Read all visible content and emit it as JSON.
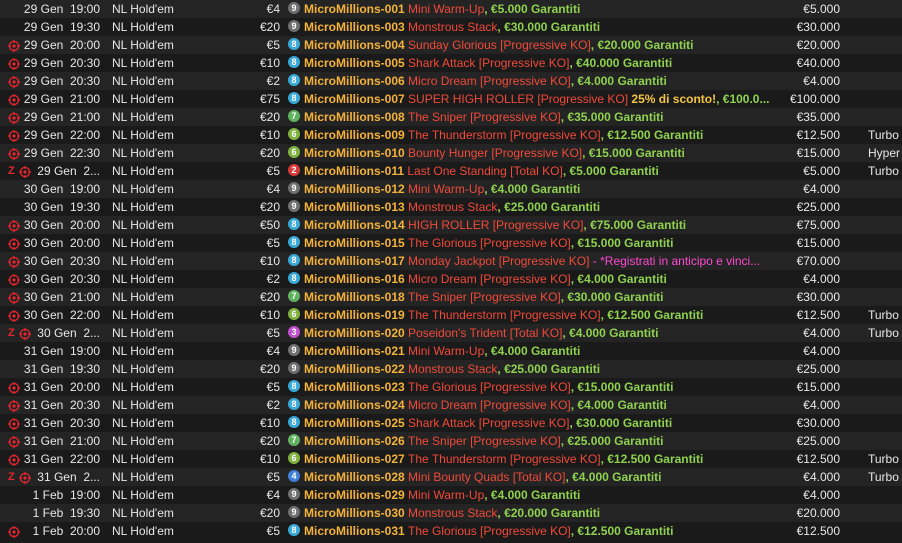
{
  "colors": {
    "code": "#f4b23b",
    "title": "#f04a3a",
    "guarantee": "#8fd14f",
    "promo": "#f4c542",
    "promo_pink": "#ff49d2",
    "ko_icon": "#e3262f",
    "badge_colors": {
      "9": "#6f6f6f",
      "8": "#39a9d8",
      "7": "#5fb35f",
      "6": "#7fb340",
      "5": "#3ec0c9",
      "4": "#3f7fd8",
      "3": "#c24fd0",
      "2": "#d63a3a"
    }
  },
  "rows": [
    {
      "ko": false,
      "z": false,
      "date": "29 Gen",
      "time": "19:00",
      "game": "NL Hold'em",
      "buyin": "€4",
      "badge": "9",
      "code": "MicroMillions-001",
      "title": "Mini Warm-Up",
      "gtd": ", €5.000 Garantiti",
      "promo": "",
      "prize": "€5.000",
      "speed": ""
    },
    {
      "ko": false,
      "z": false,
      "date": "29 Gen",
      "time": "19:30",
      "game": "NL Hold'em",
      "buyin": "€20",
      "badge": "9",
      "code": "MicroMillions-003",
      "title": "Monstrous Stack",
      "gtd": ", €30.000 Garantiti",
      "promo": "",
      "prize": "€30.000",
      "speed": ""
    },
    {
      "ko": true,
      "z": false,
      "date": "29 Gen",
      "time": "20:00",
      "game": "NL Hold'em",
      "buyin": "€5",
      "badge": "8",
      "code": "MicroMillions-004",
      "title": "Sunday Glorious [Progressive KO]",
      "gtd": ", €20.000 Garantiti",
      "promo": "",
      "prize": "€20.000",
      "speed": ""
    },
    {
      "ko": true,
      "z": false,
      "date": "29 Gen",
      "time": "20:30",
      "game": "NL Hold'em",
      "buyin": "€10",
      "badge": "8",
      "code": "MicroMillions-005",
      "title": "Shark Attack [Progressive KO]",
      "gtd": ", €40.000 Garantiti",
      "promo": "",
      "prize": "€40.000",
      "speed": ""
    },
    {
      "ko": true,
      "z": false,
      "date": "29 Gen",
      "time": "20:30",
      "game": "NL Hold'em",
      "buyin": "€2",
      "badge": "8",
      "code": "MicroMillions-006",
      "title": "Micro Dream [Progressive KO]",
      "gtd": ", €4.000 Garantiti",
      "promo": "",
      "prize": "€4.000",
      "speed": ""
    },
    {
      "ko": true,
      "z": false,
      "date": "29 Gen",
      "time": "21:00",
      "game": "NL Hold'em",
      "buyin": "€75",
      "badge": "8",
      "code": "MicroMillions-007",
      "title": "SUPER HIGH ROLLER [Progressive KO]",
      "gtd": ", €100.0...",
      "promo": "  25% di sconto!",
      "prize": "€100.000",
      "speed": ""
    },
    {
      "ko": true,
      "z": false,
      "date": "29 Gen",
      "time": "21:00",
      "game": "NL Hold'em",
      "buyin": "€20",
      "badge": "7",
      "code": "MicroMillions-008",
      "title": "The Sniper [Progressive KO]",
      "gtd": ", €35.000 Garantiti",
      "promo": "",
      "prize": "€35.000",
      "speed": ""
    },
    {
      "ko": true,
      "z": false,
      "date": "29 Gen",
      "time": "22:00",
      "game": "NL Hold'em",
      "buyin": "€10",
      "badge": "6",
      "code": "MicroMillions-009",
      "title": "The Thunderstorm [Progressive KO]",
      "gtd": ", €12.500 Garantiti",
      "promo": "",
      "prize": "€12.500",
      "speed": "Turbo"
    },
    {
      "ko": true,
      "z": false,
      "date": "29 Gen",
      "time": "22:30",
      "game": "NL Hold'em",
      "buyin": "€20",
      "badge": "6",
      "code": "MicroMillions-010",
      "title": "Bounty Hunger [Progressive KO]",
      "gtd": ", €15.000 Garantiti",
      "promo": "",
      "prize": "€15.000",
      "speed": "Hyper"
    },
    {
      "ko": true,
      "z": true,
      "date": "29 Gen",
      "time": "2...",
      "game": "NL Hold'em",
      "buyin": "€5",
      "badge": "2",
      "code": "MicroMillions-011",
      "title": "Last One Standing [Total KO]",
      "gtd": ", €5.000 Garantiti",
      "promo": "",
      "prize": "€5.000",
      "speed": "Turbo"
    },
    {
      "ko": false,
      "z": false,
      "date": "30 Gen",
      "time": "19:00",
      "game": "NL Hold'em",
      "buyin": "€4",
      "badge": "9",
      "code": "MicroMillions-012",
      "title": "Mini Warm-Up",
      "gtd": ", €4.000 Garantiti",
      "promo": "",
      "prize": "€4.000",
      "speed": ""
    },
    {
      "ko": false,
      "z": false,
      "date": "30 Gen",
      "time": "19:30",
      "game": "NL Hold'em",
      "buyin": "€20",
      "badge": "9",
      "code": "MicroMillions-013",
      "title": "Monstrous Stack",
      "gtd": ", €25.000 Garantiti",
      "promo": "",
      "prize": "€25.000",
      "speed": ""
    },
    {
      "ko": true,
      "z": false,
      "date": "30 Gen",
      "time": "20:00",
      "game": "NL Hold'em",
      "buyin": "€50",
      "badge": "8",
      "code": "MicroMillions-014",
      "title": "HIGH ROLLER [Progressive KO]",
      "gtd": ", €75.000 Garantiti",
      "promo": "",
      "prize": "€75.000",
      "speed": ""
    },
    {
      "ko": true,
      "z": false,
      "date": "30 Gen",
      "time": "20:00",
      "game": "NL Hold'em",
      "buyin": "€5",
      "badge": "8",
      "code": "MicroMillions-015",
      "title": "The Glorious [Progressive KO]",
      "gtd": ", €15.000 Garantiti",
      "promo": "",
      "prize": "€15.000",
      "speed": ""
    },
    {
      "ko": true,
      "z": false,
      "date": "30 Gen",
      "time": "20:30",
      "game": "NL Hold'em",
      "buyin": "€10",
      "badge": "8",
      "code": "MicroMillions-017",
      "title": "Monday Jackpot [Progressive KO]",
      "gtd": "",
      "promo": " - *Registrati in anticipo e vinci...",
      "prize": "€70.000",
      "speed": ""
    },
    {
      "ko": true,
      "z": false,
      "date": "30 Gen",
      "time": "20:30",
      "game": "NL Hold'em",
      "buyin": "€2",
      "badge": "8",
      "code": "MicroMillions-016",
      "title": "Micro Dream [Progressive KO]",
      "gtd": ", €4.000 Garantiti",
      "promo": "",
      "prize": "€4.000",
      "speed": ""
    },
    {
      "ko": true,
      "z": false,
      "date": "30 Gen",
      "time": "21:00",
      "game": "NL Hold'em",
      "buyin": "€20",
      "badge": "7",
      "code": "MicroMillions-018",
      "title": "The Sniper [Progressive KO]",
      "gtd": ", €30.000 Garantiti",
      "promo": "",
      "prize": "€30.000",
      "speed": ""
    },
    {
      "ko": true,
      "z": false,
      "date": "30 Gen",
      "time": "22:00",
      "game": "NL Hold'em",
      "buyin": "€10",
      "badge": "6",
      "code": "MicroMillions-019",
      "title": "The Thunderstorm [Progressive KO]",
      "gtd": ", €12.500 Garantiti",
      "promo": "",
      "prize": "€12.500",
      "speed": "Turbo"
    },
    {
      "ko": true,
      "z": true,
      "date": "30 Gen",
      "time": "2...",
      "game": "NL Hold'em",
      "buyin": "€5",
      "badge": "3",
      "code": "MicroMillions-020",
      "title": "Poseidon's Trident [Total KO]",
      "gtd": ", €4.000 Garantiti",
      "promo": "",
      "prize": "€4.000",
      "speed": "Turbo"
    },
    {
      "ko": false,
      "z": false,
      "date": "31 Gen",
      "time": "19:00",
      "game": "NL Hold'em",
      "buyin": "€4",
      "badge": "9",
      "code": "MicroMillions-021",
      "title": "Mini Warm-Up",
      "gtd": ", €4.000 Garantiti",
      "promo": "",
      "prize": "€4.000",
      "speed": ""
    },
    {
      "ko": false,
      "z": false,
      "date": "31 Gen",
      "time": "19:30",
      "game": "NL Hold'em",
      "buyin": "€20",
      "badge": "9",
      "code": "MicroMillions-022",
      "title": "Monstrous Stack",
      "gtd": ", €25.000 Garantiti",
      "promo": "",
      "prize": "€25.000",
      "speed": ""
    },
    {
      "ko": true,
      "z": false,
      "date": "31 Gen",
      "time": "20:00",
      "game": "NL Hold'em",
      "buyin": "€5",
      "badge": "8",
      "code": "MicroMillions-023",
      "title": "The Glorious [Progressive KO]",
      "gtd": ", €15.000 Garantiti",
      "promo": "",
      "prize": "€15.000",
      "speed": ""
    },
    {
      "ko": true,
      "z": false,
      "date": "31 Gen",
      "time": "20:30",
      "game": "NL Hold'em",
      "buyin": "€2",
      "badge": "8",
      "code": "MicroMillions-024",
      "title": "Micro Dream [Progressive KO]",
      "gtd": ", €4.000 Garantiti",
      "promo": "",
      "prize": "€4.000",
      "speed": ""
    },
    {
      "ko": true,
      "z": false,
      "date": "31 Gen",
      "time": "20:30",
      "game": "NL Hold'em",
      "buyin": "€10",
      "badge": "8",
      "code": "MicroMillions-025",
      "title": "Shark Attack [Progressive KO]",
      "gtd": ", €30.000 Garantiti",
      "promo": "",
      "prize": "€30.000",
      "speed": ""
    },
    {
      "ko": true,
      "z": false,
      "date": "31 Gen",
      "time": "21:00",
      "game": "NL Hold'em",
      "buyin": "€20",
      "badge": "7",
      "code": "MicroMillions-026",
      "title": "The Sniper [Progressive KO]",
      "gtd": ", €25.000 Garantiti",
      "promo": "",
      "prize": "€25.000",
      "speed": ""
    },
    {
      "ko": true,
      "z": false,
      "date": "31 Gen",
      "time": "22:00",
      "game": "NL Hold'em",
      "buyin": "€10",
      "badge": "6",
      "code": "MicroMillions-027",
      "title": "The Thunderstorm [Progressive KO]",
      "gtd": ", €12.500 Garantiti",
      "promo": "",
      "prize": "€12.500",
      "speed": "Turbo"
    },
    {
      "ko": true,
      "z": true,
      "date": "31 Gen",
      "time": "2...",
      "game": "NL Hold'em",
      "buyin": "€5",
      "badge": "4",
      "code": "MicroMillions-028",
      "title": "Mini Bounty Quads [Total KO]",
      "gtd": ", €4.000 Garantiti",
      "promo": "",
      "prize": "€4.000",
      "speed": "Turbo"
    },
    {
      "ko": false,
      "z": false,
      "date": "1 Feb",
      "time": "19:00",
      "game": "NL Hold'em",
      "buyin": "€4",
      "badge": "9",
      "code": "MicroMillions-029",
      "title": "Mini Warm-Up",
      "gtd": ", €4.000 Garantiti",
      "promo": "",
      "prize": "€4.000",
      "speed": ""
    },
    {
      "ko": false,
      "z": false,
      "date": "1 Feb",
      "time": "19:30",
      "game": "NL Hold'em",
      "buyin": "€20",
      "badge": "9",
      "code": "MicroMillions-030",
      "title": "Monstrous Stack",
      "gtd": ", €20.000 Garantiti",
      "promo": "",
      "prize": "€20.000",
      "speed": ""
    },
    {
      "ko": true,
      "z": false,
      "date": "1 Feb",
      "time": "20:00",
      "game": "NL Hold'em",
      "buyin": "€5",
      "badge": "8",
      "code": "MicroMillions-031",
      "title": "The Glorious [Progressive KO]",
      "gtd": ", €12.500 Garantiti",
      "promo": "",
      "prize": "€12.500",
      "speed": ""
    }
  ]
}
